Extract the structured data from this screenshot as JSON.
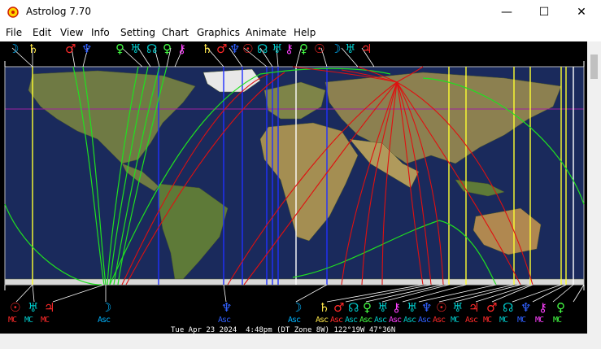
{
  "window": {
    "title": "Astrolog 7.70",
    "minimize": "—",
    "maximize": "☐",
    "close": "✕"
  },
  "menu": [
    "File",
    "Edit",
    "View",
    "Info",
    "Setting",
    "Chart",
    "Graphics",
    "Animate",
    "Help"
  ],
  "colors": {
    "sun_mars": "#ff2a2a",
    "moon_mercury": "#00b4ff",
    "venus": "#44ff44",
    "saturn": "#ffe84a",
    "uranus": "#00c8c8",
    "neptune": "#3060ff",
    "pluto": "#ff40ff",
    "chiron": "#c040ff",
    "line_green": "#20e020",
    "line_red": "#e01010",
    "line_blue": "#2030ff",
    "line_yellow": "#ffff30",
    "line_white": "#ffffff"
  },
  "top_glyphs": [
    {
      "g": "☽",
      "c": "#00b4ff"
    },
    {
      "g": "♄",
      "c": "#ffe84a"
    },
    {
      "g": "♂",
      "c": "#ff2a2a"
    },
    {
      "g": "♆",
      "c": "#3060ff"
    },
    {
      "g": "♀",
      "c": "#44ff44"
    },
    {
      "g": "♅",
      "c": "#00c8c8"
    },
    {
      "g": "☊",
      "c": "#00c8c8"
    },
    {
      "g": "♀",
      "c": "#44ff44"
    },
    {
      "g": "⚷",
      "c": "#ff40ff"
    },
    {
      "g": "♄",
      "c": "#ffe84a"
    },
    {
      "g": "♂",
      "c": "#ff2a2a"
    },
    {
      "g": "♆",
      "c": "#3060ff"
    },
    {
      "g": "☉",
      "c": "#ff2a2a"
    },
    {
      "g": "☊",
      "c": "#00c8c8"
    },
    {
      "g": "♅",
      "c": "#00c8c8"
    },
    {
      "g": "⚷",
      "c": "#ff40ff"
    },
    {
      "g": "♀",
      "c": "#44ff44"
    },
    {
      "g": "☉",
      "c": "#ff2a2a"
    },
    {
      "g": "☽",
      "c": "#00b4ff"
    },
    {
      "g": "♅",
      "c": "#00c8c8"
    },
    {
      "g": "♃",
      "c": "#ff2a2a"
    }
  ],
  "bottom_glyphs": [
    {
      "g": "☉",
      "c": "#ff2a2a"
    },
    {
      "g": "♅",
      "c": "#00c8c8"
    },
    {
      "g": "♃",
      "c": "#ff2a2a"
    },
    {
      "g": "☽",
      "c": "#00b4ff"
    },
    {
      "g": "♆",
      "c": "#3060ff"
    },
    {
      "g": "☽",
      "c": "#00b4ff"
    },
    {
      "g": "♄",
      "c": "#ffe84a"
    },
    {
      "g": "♂",
      "c": "#ff2a2a"
    },
    {
      "g": "☊",
      "c": "#00c8c8"
    },
    {
      "g": "♀",
      "c": "#44ff44"
    },
    {
      "g": "♅",
      "c": "#00c8c8"
    },
    {
      "g": "⚷",
      "c": "#ff40ff"
    },
    {
      "g": "♅",
      "c": "#00c8c8"
    },
    {
      "g": "♆",
      "c": "#3060ff"
    },
    {
      "g": "☉",
      "c": "#ff2a2a"
    },
    {
      "g": "♅",
      "c": "#00c8c8"
    },
    {
      "g": "♃",
      "c": "#ff2a2a"
    },
    {
      "g": "♂",
      "c": "#ff2a2a"
    },
    {
      "g": "☊",
      "c": "#00c8c8"
    },
    {
      "g": "♆",
      "c": "#3060ff"
    },
    {
      "g": "⚷",
      "c": "#ff40ff"
    },
    {
      "g": "♀",
      "c": "#44ff44"
    }
  ],
  "bottom_labels": [
    {
      "t": "MC",
      "c": "#ff2a2a"
    },
    {
      "t": "MC",
      "c": "#00c8c8"
    },
    {
      "t": "MC",
      "c": "#ff2a2a"
    },
    {
      "t": "Asc",
      "c": "#00b4ff"
    },
    {
      "t": "Asc",
      "c": "#3060ff"
    },
    {
      "t": "Asc",
      "c": "#00b4ff"
    },
    {
      "t": "Asc",
      "c": "#ffe84a"
    },
    {
      "t": "Asc",
      "c": "#ff2a2a"
    },
    {
      "t": "Asc",
      "c": "#00c8c8"
    },
    {
      "t": "Asc",
      "c": "#44ff44"
    },
    {
      "t": "Asc",
      "c": "#00c8c8"
    },
    {
      "t": "Asc",
      "c": "#ff40ff"
    },
    {
      "t": "Asc",
      "c": "#00c8c8"
    },
    {
      "t": "Asc",
      "c": "#3060ff"
    },
    {
      "t": "Asc",
      "c": "#ff2a2a"
    },
    {
      "t": "MC",
      "c": "#00c8c8"
    },
    {
      "t": "Asc",
      "c": "#ff2a2a"
    },
    {
      "t": "MC",
      "c": "#ff2a2a"
    },
    {
      "t": "MC",
      "c": "#00c8c8"
    },
    {
      "t": "MC",
      "c": "#3060ff"
    },
    {
      "t": "MC",
      "c": "#ff40ff"
    },
    {
      "t": "MC",
      "c": "#44ff44"
    }
  ],
  "status_line": "Tue Apr 23 2024  4:48pm (DT Zone 8W) 122°19W 47°36N"
}
